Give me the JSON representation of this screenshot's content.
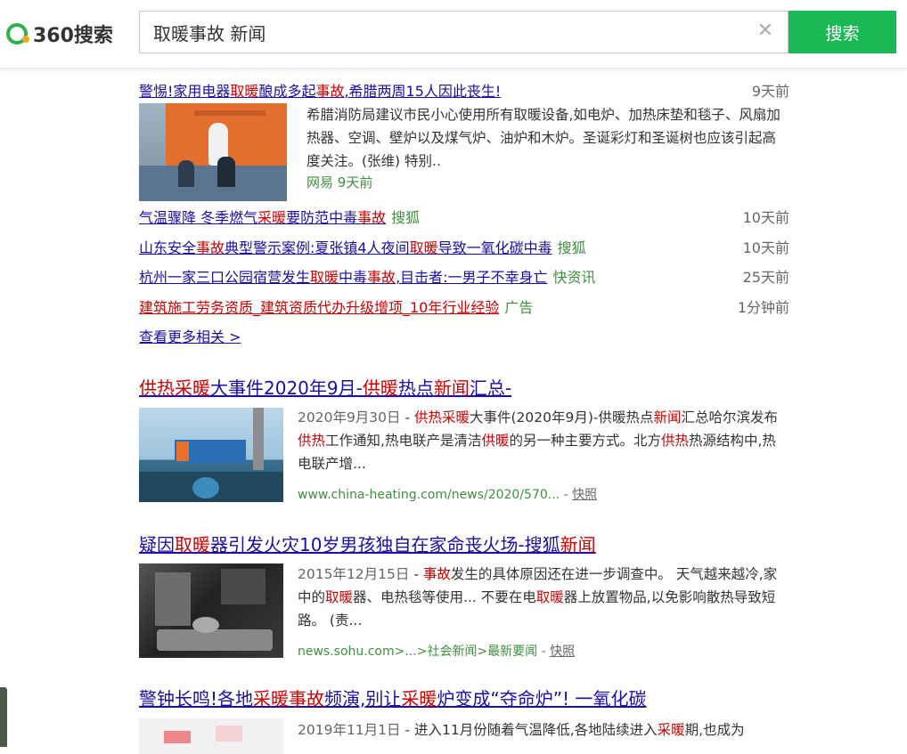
{
  "header": {
    "logo_text": "360搜索",
    "search_value": "取暖事故 新闻",
    "search_button": "搜索"
  },
  "news": {
    "items": [
      {
        "pre": "警惕!家用电器",
        "k1": "取暖",
        "mid": "酿成多起",
        "k2": "事故",
        "post": ",希腊两周15人因此丧生!",
        "src": "",
        "time": "9天前"
      },
      {
        "pre": "气温骤降 冬季燃气",
        "k1": "采暖",
        "mid": "要防范中毒",
        "k2": "事故",
        "post": "",
        "src": "搜狐",
        "time": "10天前"
      },
      {
        "pre": "山东安全",
        "k1": "事故",
        "mid": "典型警示案例:夏张镇4人夜间",
        "k2": "取暖",
        "post": "导致一氧化碳中毒",
        "src": "搜狐",
        "time": "10天前"
      },
      {
        "pre": "杭州一家三口公园宿营发生",
        "k1": "取暖",
        "mid": "中毒",
        "k2": "事故",
        "post": ",目击者:一男子不幸身亡",
        "src": "快资讯",
        "time": "25天前"
      }
    ],
    "first_desc": "希腊消防局建议市民小心使用所有取暖设备,如电炉、加热床垫和毯子、风扇加热器、空调、壁炉以及煤气炉、油炉和木炉。圣诞彩灯和圣诞树也应该引起高度关注。(张维) 特别..",
    "first_meta_source": "网易",
    "first_meta_time": "9天前",
    "ad_title": "建筑施工劳务资质_建筑资质代办升级增项_10年行业经验",
    "ad_label": "广告",
    "ad_time": "1分钟前",
    "more": "查看更多相关 >"
  },
  "results": [
    {
      "title_parts": [
        [
          "k",
          "供热采暖"
        ],
        [
          "t",
          "大事件2020年9月-"
        ],
        [
          "k",
          "供暖"
        ],
        [
          "t",
          "热点"
        ],
        [
          "k",
          "新闻"
        ],
        [
          "t",
          "汇总-"
        ]
      ],
      "date": "2020年9月30日",
      "desc_parts": [
        [
          "t",
          " - "
        ],
        [
          "k",
          "供热采暖"
        ],
        [
          "t",
          "大事件(2020年9月)-供暖热点"
        ],
        [
          "k",
          "新闻"
        ],
        [
          "t",
          "汇总哈尔滨发布"
        ],
        [
          "k",
          "供热"
        ],
        [
          "t",
          "工作通知,热电联产是清洁"
        ],
        [
          "k",
          "供暖"
        ],
        [
          "t",
          "的另一种主要方式。北方"
        ],
        [
          "k",
          "供热"
        ],
        [
          "t",
          "热源结构中,热电联产增..."
        ]
      ],
      "url": "www.china-heating.com/news/2020/570...",
      "snapshot": "快照"
    },
    {
      "title_parts": [
        [
          "t",
          "疑因"
        ],
        [
          "k",
          "取暖"
        ],
        [
          "t",
          "器引发火灾10岁男孩独自在家命丧火场-搜狐"
        ],
        [
          "k",
          "新闻"
        ]
      ],
      "date": "2015年12月15日",
      "desc_parts": [
        [
          "t",
          " - "
        ],
        [
          "k",
          "事故"
        ],
        [
          "t",
          "发生的具体原因还在进一步调查中。 天气越来越冷,家中的"
        ],
        [
          "k",
          "取暖"
        ],
        [
          "t",
          "器、电热毯等使用... 不要在电"
        ],
        [
          "k",
          "取暖"
        ],
        [
          "t",
          "器上放置物品,以免影响散热导致短路。 (责..."
        ]
      ],
      "url": "news.sohu.com>...>社会新闻>最新要闻",
      "snapshot": "快照"
    },
    {
      "title_parts": [
        [
          "t",
          "警钟长鸣!各地"
        ],
        [
          "k",
          "采暖事故"
        ],
        [
          "t",
          "频演,别让"
        ],
        [
          "k",
          "采暖"
        ],
        [
          "t",
          "炉变成“夺命炉”! 一氧化碳"
        ]
      ],
      "date": "2019年11月1日",
      "desc_parts": [
        [
          "t",
          " - 进入11月份随着气温降低,各地陆续进入"
        ],
        [
          "k",
          "采暖"
        ],
        [
          "t",
          "期,也成为"
        ]
      ],
      "url": "",
      "snapshot": ""
    }
  ],
  "colors": {
    "brand_green": "#19b955",
    "link": "#1b0ea6",
    "keyword": "#cc0000",
    "source": "#3f8f3f"
  }
}
